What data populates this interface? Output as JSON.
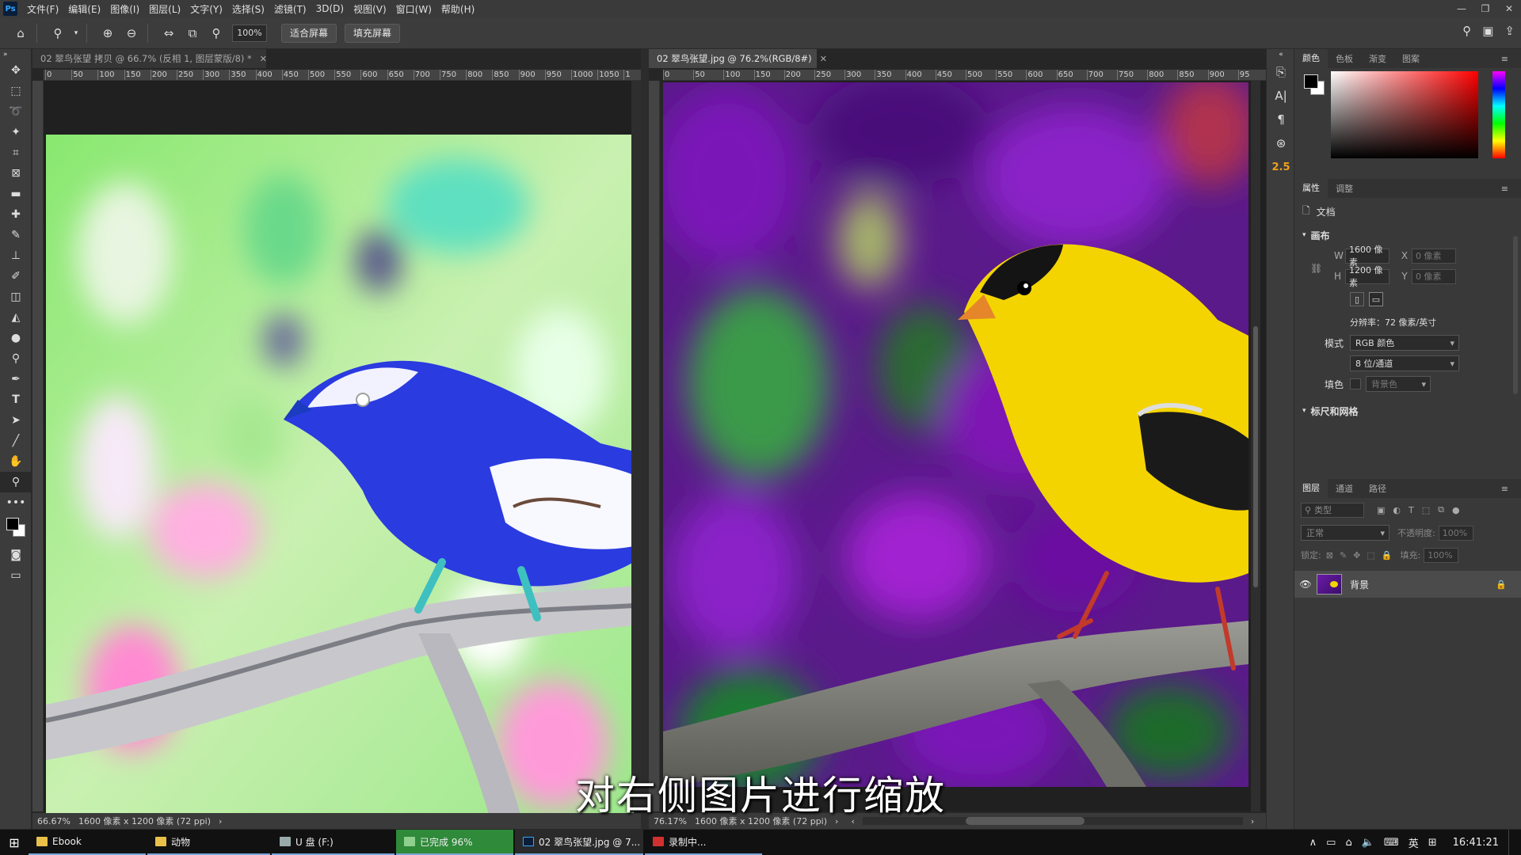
{
  "menubar": {
    "app_icon": "Ps",
    "items": [
      "文件(F)",
      "编辑(E)",
      "图像(I)",
      "图层(L)",
      "文字(Y)",
      "选择(S)",
      "滤镜(T)",
      "3D(D)",
      "视图(V)",
      "窗口(W)",
      "帮助(H)"
    ]
  },
  "options": {
    "zoom_value": "100%",
    "fit_screen_label": "适合屏幕",
    "fill_screen_label": "填充屏幕"
  },
  "left_doc": {
    "tab_title": "02 翠鸟张望 拷贝 @ 66.7% (反相 1, 图层蒙版/8) *",
    "ruler_ticks": [
      "0",
      "50",
      "100",
      "150",
      "200",
      "250",
      "300",
      "350",
      "400",
      "450",
      "500",
      "550",
      "600",
      "650",
      "700",
      "750",
      "800",
      "850",
      "900",
      "950",
      "1000",
      "1050",
      "1"
    ],
    "zoom": "66.67%",
    "size": "1600 像素 x 1200 像素 (72 ppi)"
  },
  "right_doc": {
    "tab_title": "02 翠鸟张望.jpg @ 76.2%(RGB/8#)",
    "ruler_ticks": [
      "0",
      "50",
      "100",
      "150",
      "200",
      "250",
      "300",
      "350",
      "400",
      "450",
      "500",
      "550",
      "600",
      "650",
      "700",
      "750",
      "800",
      "850",
      "900",
      "95"
    ],
    "zoom": "76.17%",
    "size": "1600 像素 x 1200 像素 (72 ppi)"
  },
  "color_panel": {
    "tabs": [
      "颜色",
      "色板",
      "渐变",
      "图案"
    ]
  },
  "properties": {
    "tabs": [
      "属性",
      "调整"
    ],
    "doc_label": "文档",
    "canvas_section": "画布",
    "w_label": "W",
    "w_value": "1600 像素",
    "h_label": "H",
    "h_value": "1200 像素",
    "x_label": "X",
    "x_placeholder": "0 像素",
    "y_label": "Y",
    "y_placeholder": "0 像素",
    "resolution": "分辨率：72 像素/英寸",
    "mode_label": "模式",
    "mode_value": "RGB 颜色",
    "depth_value": "8 位/通道",
    "fill_label": "填色",
    "fill_value": "背景色",
    "rulers_section": "标尺和网格"
  },
  "layers": {
    "tabs": [
      "图层",
      "通道",
      "路径"
    ],
    "filter_placeholder": "类型",
    "blend_mode": "正常",
    "opacity_label": "不透明度:",
    "opacity_value": "100%",
    "lock_label": "锁定:",
    "fill_label": "填充:",
    "fill_value": "100%",
    "layer_name": "背景"
  },
  "iconstrip": {
    "brush_size": "2.5"
  },
  "subtitle": "对右侧图片进行缩放",
  "taskbar": {
    "items": [
      "Ebook",
      "动物",
      "U 盘 (F:)",
      "已完成 96%",
      "02 翠鸟张望.jpg @ 7...",
      "录制中..."
    ],
    "ime": "英",
    "time": "16:41:21"
  }
}
